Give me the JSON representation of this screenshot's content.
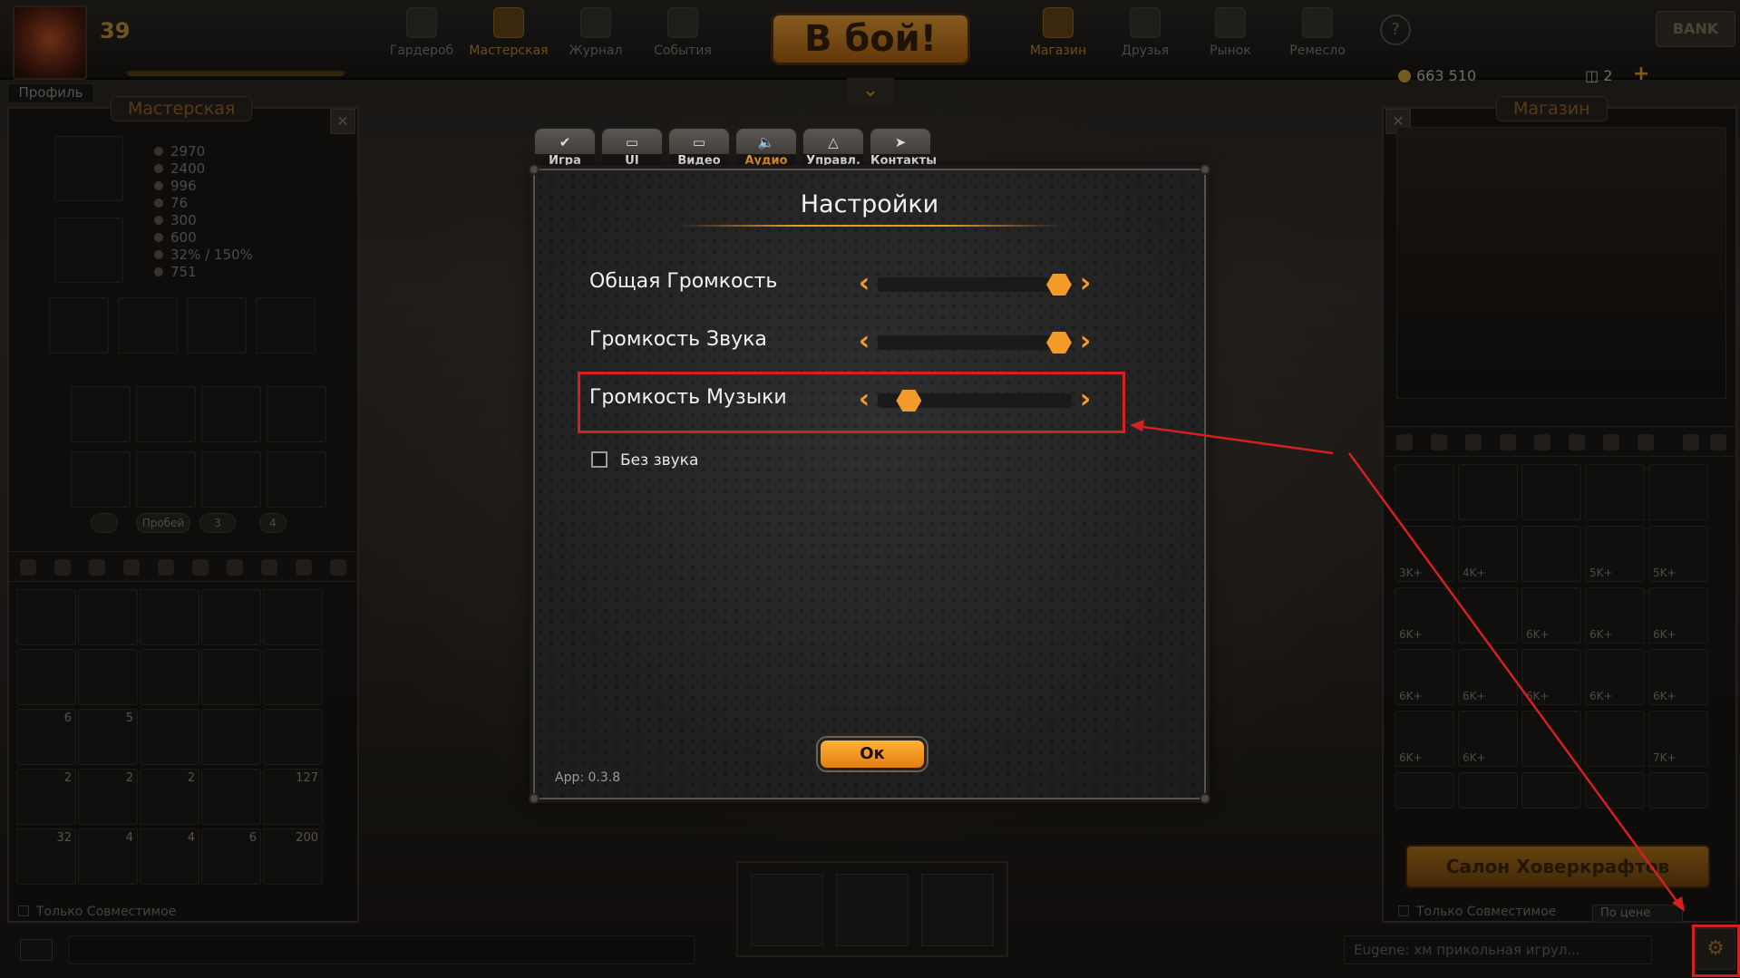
{
  "header": {
    "level": "39",
    "profile_label": "Профиль",
    "nav": [
      {
        "label": "Гардероб",
        "icon": "wardrobe-icon"
      },
      {
        "label": "Мастерская",
        "icon": "wrench-icon"
      },
      {
        "label": "Журнал",
        "icon": "journal-icon"
      },
      {
        "label": "События",
        "icon": "calendar-icon"
      }
    ],
    "battle_label": "В бой!",
    "nav_right": [
      {
        "label": "Магазин",
        "icon": "cart-icon"
      },
      {
        "label": "Друзья",
        "icon": "handshake-icon"
      },
      {
        "label": "Рынок",
        "icon": "market-icon"
      },
      {
        "label": "Ремесло",
        "icon": "gear-icon"
      }
    ],
    "bank_label": "BANK",
    "gold": "663 510",
    "gems": "2"
  },
  "workshop": {
    "title": "Мастерская",
    "stats": [
      "2970",
      "2400",
      "996",
      "76",
      "300",
      "600",
      "32% / 150%",
      "751"
    ],
    "tiny_buttons": [
      "Пробей",
      "3",
      "4"
    ],
    "inventory_counts": [
      "6",
      "5",
      "2",
      "2",
      "2",
      "127",
      "32",
      "4",
      "4",
      "6",
      "200"
    ],
    "filter_label": "Только Совместимое"
  },
  "shop": {
    "title": "Магазин",
    "price_tags": [
      "3K+",
      "4K+",
      "5K+",
      "5K+",
      "6K+",
      "6K+",
      "6K+",
      "6K+",
      "6K+",
      "6K+",
      "6K+",
      "6K+",
      "6K+",
      "6K+",
      "6K+",
      "7K+"
    ],
    "salon_label": "Салон Ховеркрафтов",
    "filter_label": "Только Совместимое",
    "sort_label": "По цене"
  },
  "chat": {
    "message": "Eugene: хм прикольная игрул..."
  },
  "settings": {
    "title": "Настройки",
    "tabs": [
      {
        "label": "Игра",
        "icon": "check-icon",
        "active": false
      },
      {
        "label": "UI",
        "icon": "monitor-icon",
        "active": false
      },
      {
        "label": "Видео",
        "icon": "display-icon",
        "active": false
      },
      {
        "label": "Аудио",
        "icon": "speaker-icon",
        "active": true
      },
      {
        "label": "Управл.",
        "icon": "gamepad-icon",
        "active": false
      },
      {
        "label": "Контакты",
        "icon": "share-icon",
        "active": false
      }
    ],
    "rows": [
      {
        "label": "Общая Громкость",
        "value": 1.0
      },
      {
        "label": "Громкость Звука",
        "value": 1.0
      },
      {
        "label": "Громкость Музыки",
        "value": 0.1
      }
    ],
    "mute_label": "Без звука",
    "mute_checked": false,
    "ok_label": "Ок",
    "version": "App: 0.3.8"
  },
  "colors": {
    "accent": "#f29a2a",
    "annotation": "#d32020"
  }
}
